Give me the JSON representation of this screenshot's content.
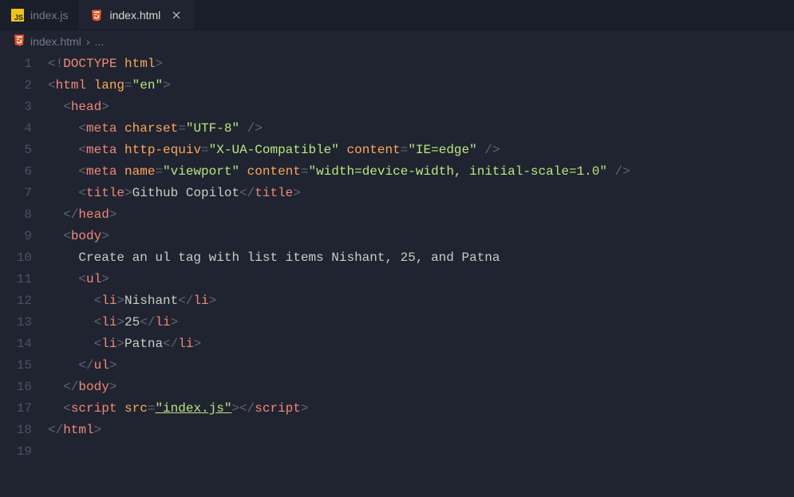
{
  "tabs": [
    {
      "label": "index.js",
      "icon": "js"
    },
    {
      "label": "index.html",
      "icon": "html",
      "active": true,
      "close": true
    }
  ],
  "breadcrumb": {
    "icon": "html",
    "file": "index.html",
    "sep": "›",
    "more": "..."
  },
  "gutter": [
    "1",
    "2",
    "3",
    "4",
    "5",
    "6",
    "7",
    "8",
    "9",
    "10",
    "11",
    "12",
    "13",
    "14",
    "15",
    "16",
    "17",
    "18",
    "19"
  ],
  "code": {
    "l1": {
      "a": "<!",
      "b": "DOCTYPE",
      "c": " html",
      "d": ">"
    },
    "l2": {
      "a": "<",
      "b": "html",
      "c": " lang",
      "d": "=",
      "e": "\"en\"",
      "f": ">"
    },
    "l3": {
      "a": "  <",
      "b": "head",
      "c": ">"
    },
    "l4": {
      "a": "    <",
      "b": "meta",
      "c": " charset",
      "d": "=",
      "e": "\"UTF-8\"",
      "f": " />"
    },
    "l5": {
      "a": "    <",
      "b": "meta",
      "c": " http-equiv",
      "d": "=",
      "e": "\"X-UA-Compatible\"",
      "f": " content",
      "g": "=",
      "h": "\"IE=edge\"",
      "i": " />"
    },
    "l6": {
      "a": "    <",
      "b": "meta",
      "c": " name",
      "d": "=",
      "e": "\"viewport\"",
      "f": " content",
      "g": "=",
      "h": "\"width=device-width, initial-scale=1.0\"",
      "i": " />"
    },
    "l7": {
      "a": "    <",
      "b": "title",
      "c": ">",
      "d": "Github Copilot",
      "e": "</",
      "f": "title",
      "g": ">"
    },
    "l8": {
      "a": "  </",
      "b": "head",
      "c": ">"
    },
    "l9": {
      "a": "  <",
      "b": "body",
      "c": ">"
    },
    "l10": {
      "a": "    Create an ul tag with list items Nishant, 25, and Patna"
    },
    "l11": {
      "a": "    <",
      "b": "ul",
      "c": ">"
    },
    "l12": {
      "a": "      <",
      "b": "li",
      "c": ">",
      "d": "Nishant",
      "e": "</",
      "f": "li",
      "g": ">"
    },
    "l13": {
      "a": "      <",
      "b": "li",
      "c": ">",
      "d": "25",
      "e": "</",
      "f": "li",
      "g": ">"
    },
    "l14": {
      "a": "      <",
      "b": "li",
      "c": ">",
      "d": "Patna",
      "e": "</",
      "f": "li",
      "g": ">"
    },
    "l15": {
      "a": "    </",
      "b": "ul",
      "c": ">"
    },
    "l16": {
      "a": "  </",
      "b": "body",
      "c": ">"
    },
    "l17": {
      "a": "  <",
      "b": "script",
      "c": " src",
      "d": "=",
      "e": "\"index.js\"",
      "f": ">",
      "g": "</",
      "h": "script",
      "i": ">"
    },
    "l18": {
      "a": "</",
      "b": "html",
      "c": ">"
    },
    "l19": {
      "a": ""
    }
  }
}
